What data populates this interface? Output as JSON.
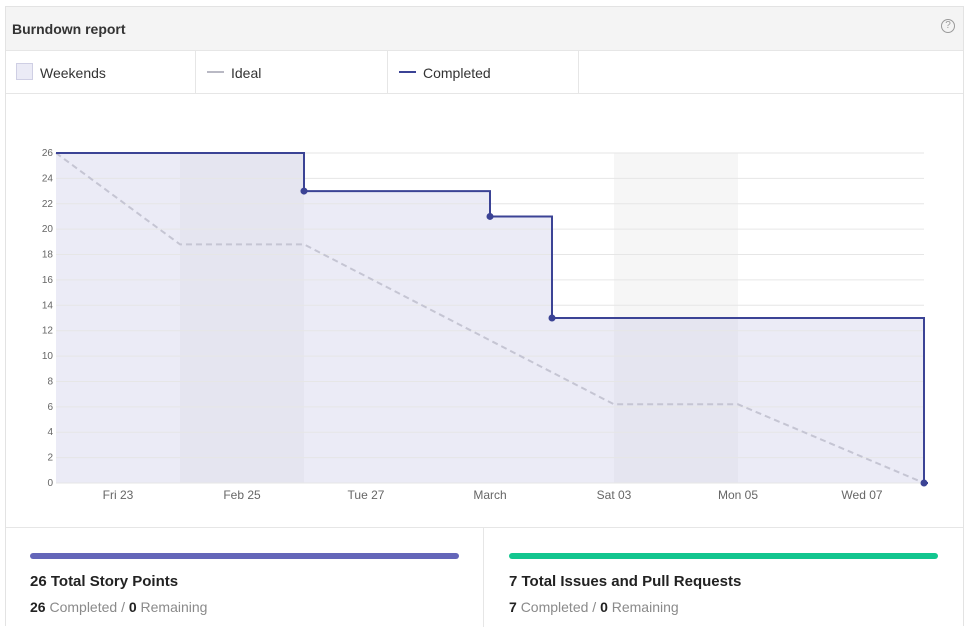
{
  "header": {
    "title": "Burndown report",
    "help_icon": "question-circle-icon"
  },
  "legend": {
    "weekends_label": "Weekends",
    "ideal_label": "Ideal",
    "completed_label": "Completed"
  },
  "colors": {
    "completed": "#3b4395",
    "ideal": "#c5c5d3",
    "fill": "#ebebf6",
    "weekend": "#e4e4f0",
    "weekend_outside": "#f6f6f6",
    "points_bar": "#6466b9",
    "issues_bar": "#12c68f"
  },
  "chart_data": {
    "type": "line",
    "title": "",
    "xlabel": "",
    "ylabel": "",
    "ylim": [
      0,
      26
    ],
    "y_ticks": [
      0,
      2,
      4,
      6,
      8,
      10,
      12,
      14,
      16,
      18,
      20,
      22,
      24,
      26
    ],
    "x_ticks": [
      "Fri 23",
      "Feb 25",
      "Tue 27",
      "March",
      "Sat 03",
      "Mon 05",
      "Wed 07"
    ],
    "x_domain": [
      "2018-02-22",
      "2018-03-08"
    ],
    "weekends": [
      [
        "2018-02-24",
        "2018-02-26"
      ],
      [
        "2018-03-03",
        "2018-03-05"
      ]
    ],
    "grid": true,
    "legend_position": "top",
    "series": [
      {
        "name": "Ideal",
        "style": "dashed",
        "x": [
          "2018-02-22",
          "2018-02-24",
          "2018-02-26",
          "2018-03-03",
          "2018-03-05",
          "2018-03-08"
        ],
        "y": [
          26,
          18.8,
          18.8,
          6.2,
          6.2,
          0
        ]
      },
      {
        "name": "Completed",
        "style": "step",
        "x": [
          "2018-02-22",
          "2018-02-26",
          "2018-02-26",
          "2018-03-01",
          "2018-03-01",
          "2018-03-02",
          "2018-03-02",
          "2018-03-08",
          "2018-03-08",
          "2018-03-08"
        ],
        "y": [
          26,
          26,
          23,
          23,
          21,
          21,
          13,
          13,
          0,
          0
        ],
        "markers": [
          {
            "x": "2018-02-26",
            "y": 23
          },
          {
            "x": "2018-03-01",
            "y": 21
          },
          {
            "x": "2018-03-02",
            "y": 13
          },
          {
            "x": "2018-03-08",
            "y": 0
          }
        ]
      }
    ]
  },
  "stats": {
    "points": {
      "title": "26 Total Story Points",
      "completed": "26",
      "completed_label": "Completed",
      "separator": "/",
      "remaining": "0",
      "remaining_label": "Remaining",
      "progress": 1.0
    },
    "issues": {
      "title": "7 Total Issues and Pull Requests",
      "completed": "7",
      "completed_label": "Completed",
      "separator": "/",
      "remaining": "0",
      "remaining_label": "Remaining",
      "progress": 1.0
    }
  }
}
